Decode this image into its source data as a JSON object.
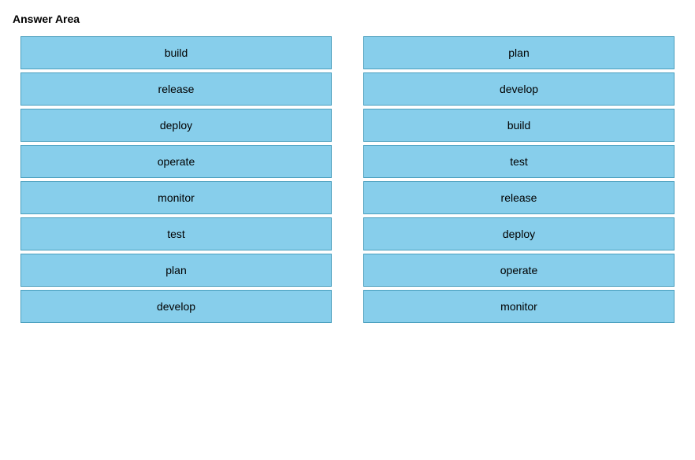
{
  "page": {
    "title": "Answer Area"
  },
  "left_column": {
    "items": [
      {
        "label": "build"
      },
      {
        "label": "release"
      },
      {
        "label": "deploy"
      },
      {
        "label": "operate"
      },
      {
        "label": "monitor"
      },
      {
        "label": "test"
      },
      {
        "label": "plan"
      },
      {
        "label": "develop"
      }
    ]
  },
  "right_column": {
    "items": [
      {
        "label": "plan"
      },
      {
        "label": "develop"
      },
      {
        "label": "build"
      },
      {
        "label": "test"
      },
      {
        "label": "release"
      },
      {
        "label": "deploy"
      },
      {
        "label": "operate"
      },
      {
        "label": "monitor"
      }
    ]
  }
}
